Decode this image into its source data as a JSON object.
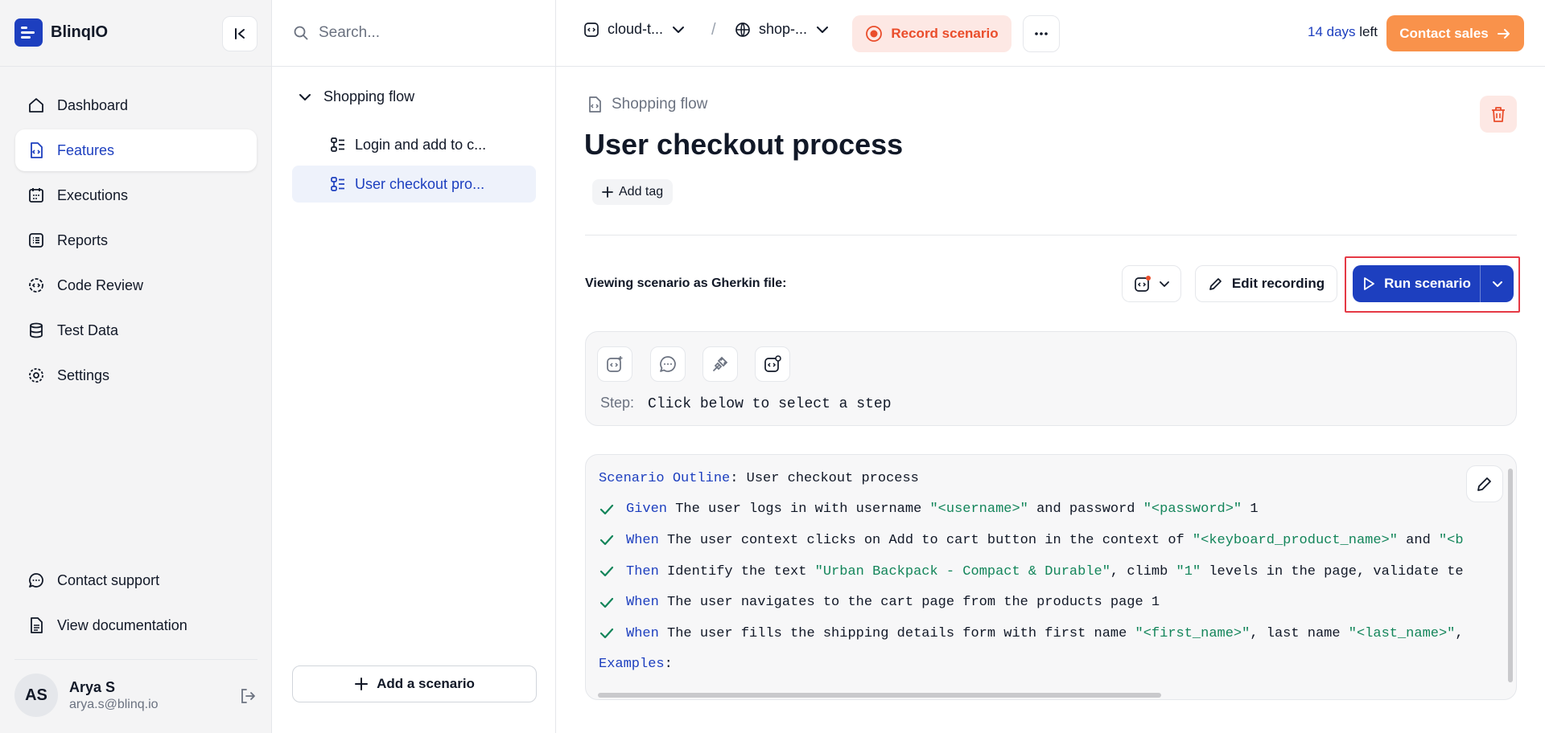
{
  "sidebar": {
    "brand": "BlinqIO",
    "nav": [
      {
        "label": "Dashboard",
        "icon": "home-icon"
      },
      {
        "label": "Features",
        "icon": "features-icon",
        "active": true
      },
      {
        "label": "Executions",
        "icon": "calendar-icon"
      },
      {
        "label": "Reports",
        "icon": "list-icon"
      },
      {
        "label": "Code Review",
        "icon": "gear-code-icon"
      },
      {
        "label": "Test Data",
        "icon": "database-icon"
      },
      {
        "label": "Settings",
        "icon": "settings-icon"
      }
    ],
    "bottom": [
      {
        "label": "Contact support",
        "icon": "chat-icon"
      },
      {
        "label": "View documentation",
        "icon": "document-icon"
      }
    ],
    "user": {
      "initials": "AS",
      "name": "Arya S",
      "email": "arya.s@blinq.io"
    }
  },
  "tree": {
    "search_placeholder": "Search...",
    "folder": "Shopping flow",
    "items": [
      {
        "label": "Login and add to c..."
      },
      {
        "label": "User checkout pro...",
        "selected": true
      }
    ],
    "add_scenario": "Add a scenario"
  },
  "topbar": {
    "project": "cloud-t...",
    "environment": "shop-...",
    "separator": "/",
    "record": "Record scenario",
    "trial_days": "14 days",
    "trial_suffix": "left",
    "contact_sales": "Contact sales"
  },
  "main": {
    "breadcrumb": "Shopping flow",
    "title": "User checkout process",
    "add_tag": "Add tag",
    "viewing_label": "Viewing scenario as Gherkin file:",
    "edit_recording": "Edit recording",
    "run_scenario": "Run scenario",
    "step_label": "Step:",
    "step_value": "Click below to select a step",
    "code": {
      "outline_keyword": "Scenario Outline",
      "outline_name": ": User checkout process",
      "lines": [
        {
          "kw": "Given",
          "parts": [
            {
              "t": " The user logs in with username "
            },
            {
              "s": "\"<username>\""
            },
            {
              "t": " and password "
            },
            {
              "s": "\"<password>\""
            },
            {
              "t": " 1"
            }
          ]
        },
        {
          "kw": "When",
          "parts": [
            {
              "t": " The user context clicks on Add to cart button in the context of "
            },
            {
              "s": "\"<keyboard_product_name>\""
            },
            {
              "t": " and "
            },
            {
              "s": "\"<b"
            }
          ]
        },
        {
          "kw": "Then",
          "parts": [
            {
              "t": " Identify the text "
            },
            {
              "s": "\"Urban Backpack - Compact & Durable\""
            },
            {
              "t": ", climb "
            },
            {
              "s": "\"1\""
            },
            {
              "t": " levels in the page, validate te"
            }
          ]
        },
        {
          "kw": "When",
          "parts": [
            {
              "t": " The user navigates to the cart page from the products page 1"
            }
          ]
        },
        {
          "kw": "When",
          "parts": [
            {
              "t": " The user fills the shipping details form with first name "
            },
            {
              "s": "\"<first_name>\""
            },
            {
              "t": ", last name "
            },
            {
              "s": "\"<last_name>\""
            },
            {
              "t": ","
            }
          ]
        }
      ],
      "examples_keyword": "Examples",
      "examples_suffix": ":"
    }
  },
  "colors": {
    "brand": "#1d3fbf",
    "record": "#ea4d2b",
    "contact": "#f9924b",
    "check": "#13855a",
    "highlight": "#e53945"
  }
}
